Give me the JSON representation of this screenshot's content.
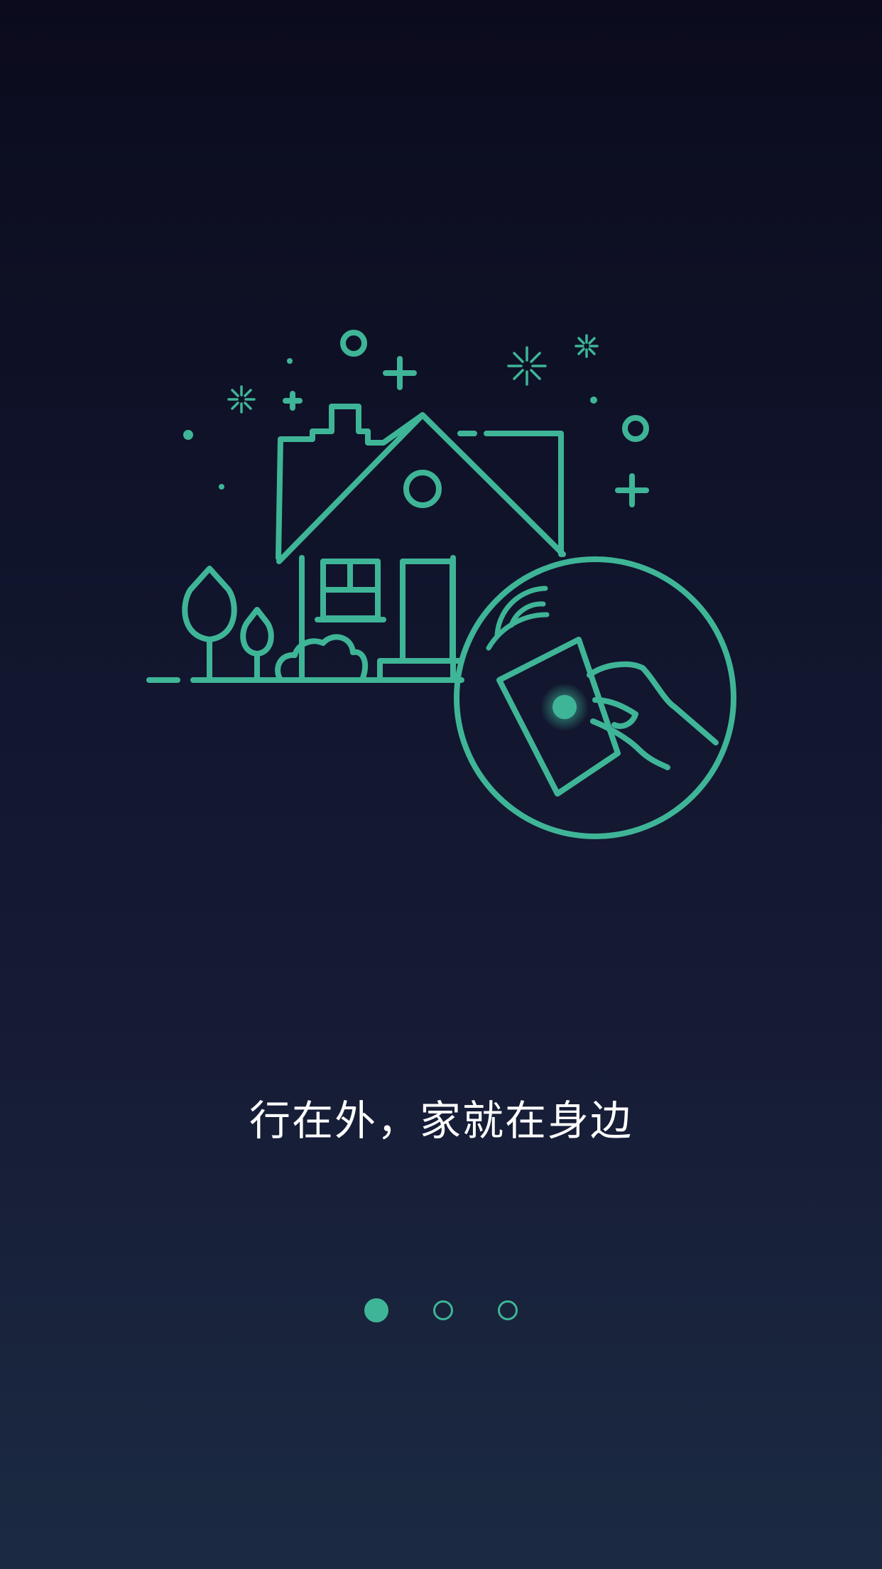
{
  "onboarding": {
    "tagline": "行在外，家就在身边",
    "illustration_icon": "smart-home-card-icon",
    "pages": [
      {
        "active": true
      },
      {
        "active": false
      },
      {
        "active": false
      }
    ]
  },
  "colors": {
    "accent": "#3fb597",
    "background_top": "#0b0b1d",
    "background_bottom": "#1b2a42",
    "text": "#ffffff"
  }
}
